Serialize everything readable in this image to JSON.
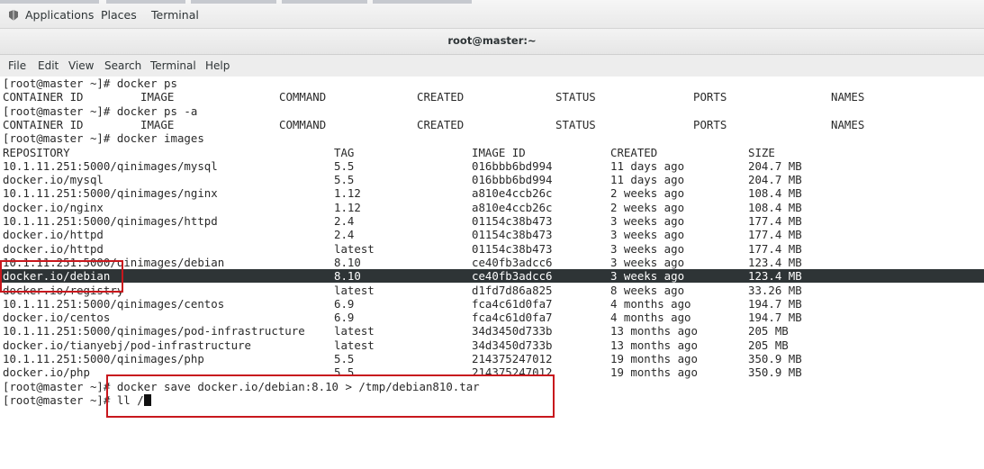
{
  "top_panel": {
    "applications": "Applications",
    "places": "Places",
    "terminal": "Terminal"
  },
  "window": {
    "title": "root@master:~"
  },
  "menu": [
    "File",
    "Edit",
    "View",
    "Search",
    "Terminal",
    "Help"
  ],
  "terminal": {
    "cmd_ps": "[root@master ~]# docker ps",
    "ps_headers": [
      "CONTAINER ID",
      "IMAGE",
      "COMMAND",
      "CREATED",
      "STATUS",
      "PORTS",
      "NAMES"
    ],
    "cmd_ps_a": "[root@master ~]# docker ps -a",
    "cmd_images": "[root@master ~]# docker images",
    "image_headers": [
      "REPOSITORY",
      "TAG",
      "IMAGE ID",
      "CREATED",
      "SIZE"
    ],
    "images": [
      [
        "10.1.11.251:5000/qinimages/mysql",
        "5.5",
        "016bbb6bd994",
        "11 days ago",
        "204.7 MB"
      ],
      [
        "docker.io/mysql",
        "5.5",
        "016bbb6bd994",
        "11 days ago",
        "204.7 MB"
      ],
      [
        "10.1.11.251:5000/qinimages/nginx",
        "1.12",
        "a810e4ccb26c",
        "2 weeks ago",
        "108.4 MB"
      ],
      [
        "docker.io/nginx",
        "1.12",
        "a810e4ccb26c",
        "2 weeks ago",
        "108.4 MB"
      ],
      [
        "10.1.11.251:5000/qinimages/httpd",
        "2.4",
        "01154c38b473",
        "3 weeks ago",
        "177.4 MB"
      ],
      [
        "docker.io/httpd",
        "2.4",
        "01154c38b473",
        "3 weeks ago",
        "177.4 MB"
      ],
      [
        "docker.io/httpd",
        "latest",
        "01154c38b473",
        "3 weeks ago",
        "177.4 MB"
      ],
      [
        "10.1.11.251:5000/qinimages/debian",
        "8.10",
        "ce40fb3adcc6",
        "3 weeks ago",
        "123.4 MB"
      ],
      [
        "docker.io/debian",
        "8.10",
        "ce40fb3adcc6",
        "3 weeks ago",
        "123.4 MB"
      ],
      [
        "docker.io/registry",
        "latest",
        "d1fd7d86a825",
        "8 weeks ago",
        "33.26 MB"
      ],
      [
        "10.1.11.251:5000/qinimages/centos",
        "6.9",
        "fca4c61d0fa7",
        "4 months ago",
        "194.7 MB"
      ],
      [
        "docker.io/centos",
        "6.9",
        "fca4c61d0fa7",
        "4 months ago",
        "194.7 MB"
      ],
      [
        "10.1.11.251:5000/qinimages/pod-infrastructure",
        "latest",
        "34d3450d733b",
        "13 months ago",
        "205 MB"
      ],
      [
        "docker.io/tianyebj/pod-infrastructure",
        "latest",
        "34d3450d733b",
        "13 months ago",
        "205 MB"
      ],
      [
        "10.1.11.251:5000/qinimages/php",
        "5.5",
        "214375247012",
        "19 months ago",
        "350.9 MB"
      ],
      [
        "docker.io/php",
        "5.5",
        "214375247012",
        "19 months ago",
        "350.9 MB"
      ]
    ],
    "cmd_save": "[root@master ~]# docker save docker.io/debian:8.10 > /tmp/debian810.tar",
    "cmd_ll": "[root@master ~]# ll /"
  },
  "colors": {
    "highlight_row": "#2e3436",
    "annotation_box": "#c8171d"
  }
}
